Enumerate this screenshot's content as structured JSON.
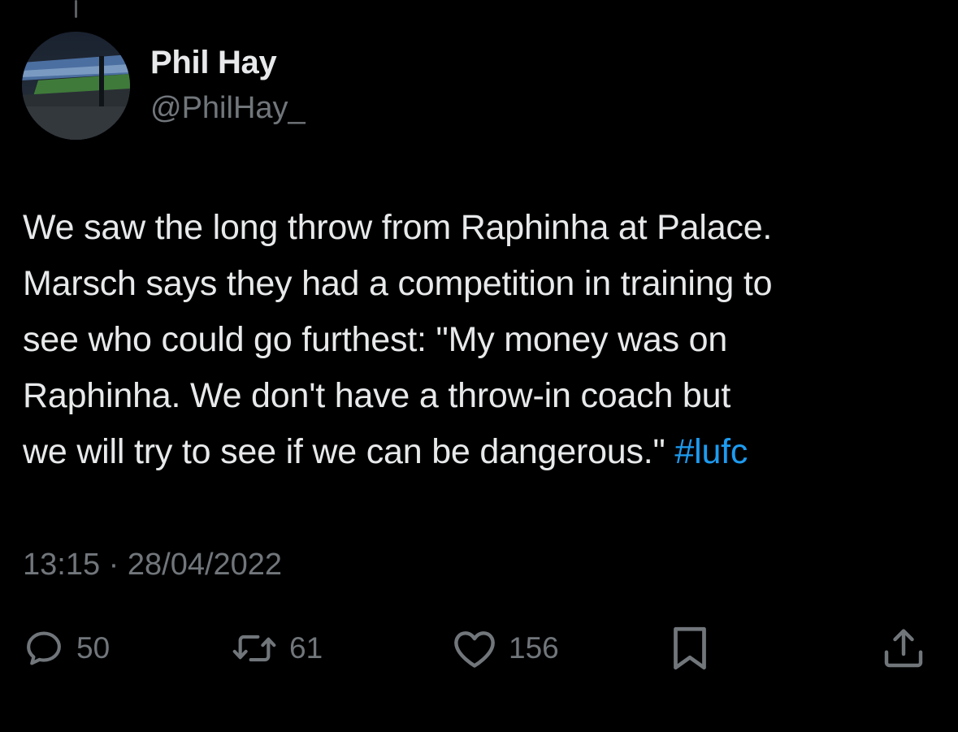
{
  "author": {
    "name": "Phil Hay",
    "handle": "@PhilHay_"
  },
  "tweet": {
    "text": "We saw the long throw from Raphinha at Palace.\nMarsch says they had a competition in training to\nsee who could go furthest: \"My money was on\nRaphinha. We don't have a throw-in coach but\nwe will try to see if we can be dangerous.\" ",
    "hashtag": "#lufc",
    "timestamp": "13:15 · 28/04/2022"
  },
  "actions": {
    "replies": "50",
    "retweets": "61",
    "likes": "156"
  },
  "icons": {
    "reply": "reply-icon",
    "retweet": "retweet-icon",
    "like": "heart-icon",
    "bookmark": "bookmark-icon",
    "share": "share-icon"
  },
  "colors": {
    "background": "#000000",
    "text": "#e7e9ea",
    "secondary": "#71767b",
    "link": "#1d9bf0"
  }
}
